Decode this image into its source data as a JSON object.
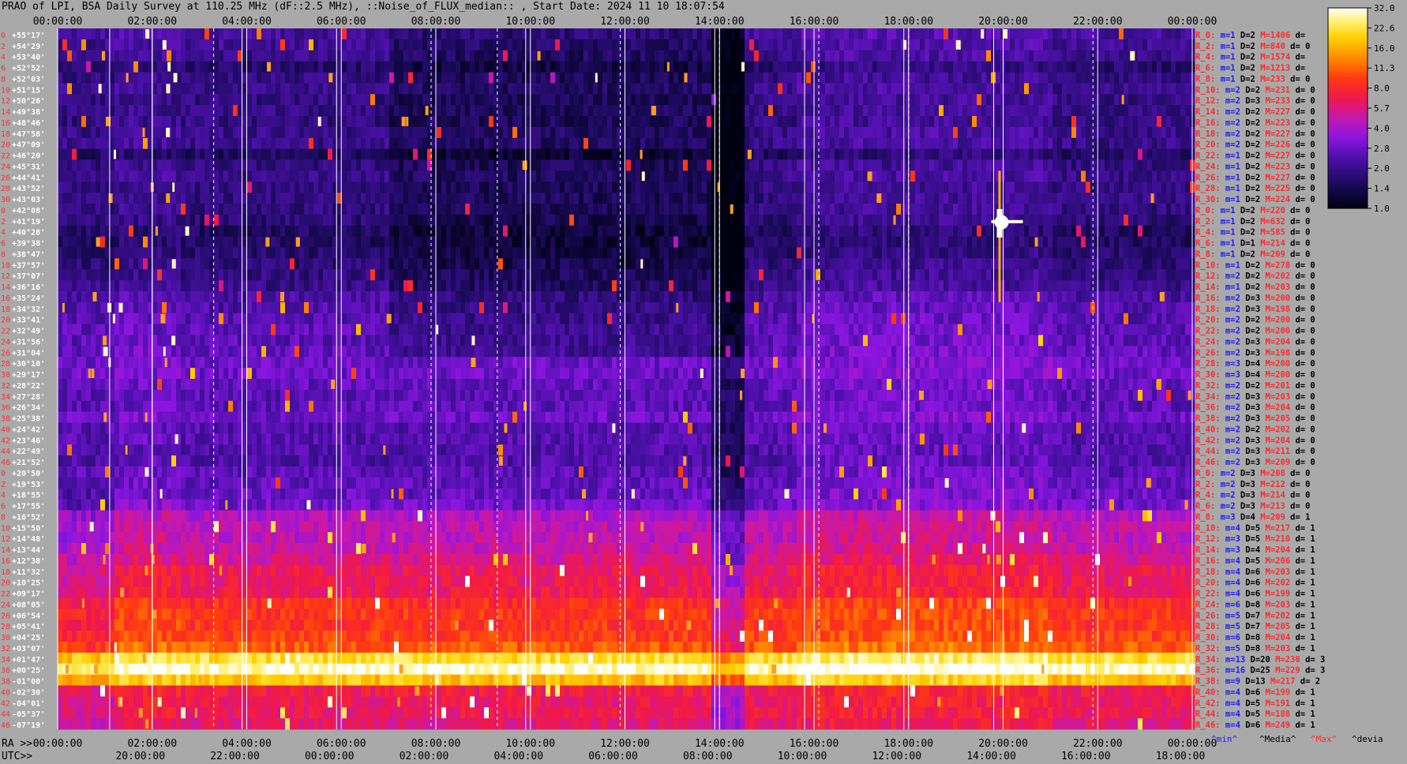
{
  "title": "PRAO of LPI, BSA Daily Survey at 110.25 MHz (dF::2.5 MHz), ::Noise_of_FLUX_median:: , Start Date: 2024 11 10 18:07:54",
  "colors": {
    "background": "#a9a9a9",
    "grid_line": "#ffffff",
    "left_labels": "#ff3030",
    "right_red": "#ff2a2a",
    "right_blue": "#1a1aff"
  },
  "chart_data": {
    "type": "heatmap",
    "title": "PRAO of LPI, BSA Daily Survey at 110.25 MHz (dF::2.5 MHz), ::Noise_of_FLUX_median:: , Start Date: 2024 11 10 18:07:54",
    "x_top_ticks": [
      "00:00:00",
      "02:00:00",
      "04:00:00",
      "06:00:00",
      "08:00:00",
      "10:00:00",
      "12:00:00",
      "14:00:00",
      "16:00:00",
      "18:00:00",
      "20:00:00",
      "22:00:00",
      "00:00:00"
    ],
    "x_bottom_ra_prefix": "RA >>",
    "x_bottom_ra_ticks": [
      "00:00:00",
      "02:00:00",
      "04:00:00",
      "06:00:00",
      "08:00:00",
      "10:00:00",
      "12:00:00",
      "14:00:00",
      "16:00:00",
      "18:00:00",
      "20:00:00",
      "22:00:00",
      "00:00:00"
    ],
    "x_bottom_utc_prefix": "UTC>>",
    "x_bottom_utc_ticks": [
      "20:00:00",
      "22:00:00",
      "00:00:00",
      "02:00:00",
      "04:00:00",
      "06:00:00",
      "08:00:00",
      "10:00:00",
      "12:00:00",
      "14:00:00",
      "16:00:00",
      "18:00:00"
    ],
    "rows": [
      {
        "idx": "0",
        "dec": "+55°17'"
      },
      {
        "idx": "2",
        "dec": "+54°29'"
      },
      {
        "idx": "4",
        "dec": "+53°40'"
      },
      {
        "idx": "6",
        "dec": "+52°52'"
      },
      {
        "idx": "8",
        "dec": "+52°03'"
      },
      {
        "idx": "10",
        "dec": "+51°15'"
      },
      {
        "idx": "12",
        "dec": "+50°26'"
      },
      {
        "idx": "14",
        "dec": "+49°38'"
      },
      {
        "idx": "16",
        "dec": "+48°46'"
      },
      {
        "idx": "18",
        "dec": "+47°58'"
      },
      {
        "idx": "20",
        "dec": "+47°09'"
      },
      {
        "idx": "22",
        "dec": "+46°20'"
      },
      {
        "idx": "24",
        "dec": "+45°31'"
      },
      {
        "idx": "26",
        "dec": "+44°41'"
      },
      {
        "idx": "28",
        "dec": "+43°52'"
      },
      {
        "idx": "30",
        "dec": "+43°03'"
      },
      {
        "idx": "0",
        "dec": "+42°08'"
      },
      {
        "idx": "2",
        "dec": "+41°19'"
      },
      {
        "idx": "4",
        "dec": "+40°28'"
      },
      {
        "idx": "6",
        "dec": "+39°38'"
      },
      {
        "idx": "8",
        "dec": "+38°47'"
      },
      {
        "idx": "10",
        "dec": "+37°57'"
      },
      {
        "idx": "12",
        "dec": "+37°07'"
      },
      {
        "idx": "14",
        "dec": "+36°16'"
      },
      {
        "idx": "16",
        "dec": "+35°24'"
      },
      {
        "idx": "18",
        "dec": "+34°32'"
      },
      {
        "idx": "20",
        "dec": "+33°41'"
      },
      {
        "idx": "22",
        "dec": "+32°49'"
      },
      {
        "idx": "24",
        "dec": "+31°56'"
      },
      {
        "idx": "26",
        "dec": "+31°04'"
      },
      {
        "idx": "28",
        "dec": "+30°10'"
      },
      {
        "idx": "30",
        "dec": "+29°17'"
      },
      {
        "idx": "32",
        "dec": "+28°22'"
      },
      {
        "idx": "34",
        "dec": "+27°28'"
      },
      {
        "idx": "36",
        "dec": "+26°34'"
      },
      {
        "idx": "38",
        "dec": "+25°38'"
      },
      {
        "idx": "40",
        "dec": "+24°42'"
      },
      {
        "idx": "42",
        "dec": "+23°46'"
      },
      {
        "idx": "44",
        "dec": "+22°49'"
      },
      {
        "idx": "46",
        "dec": "+21°52'"
      },
      {
        "idx": "0",
        "dec": "+20°50'"
      },
      {
        "idx": "2",
        "dec": "+19°53'"
      },
      {
        "idx": "4",
        "dec": "+18°55'"
      },
      {
        "idx": "6",
        "dec": "+17°55'"
      },
      {
        "idx": "8",
        "dec": "+16°52'"
      },
      {
        "idx": "10",
        "dec": "+15°50'"
      },
      {
        "idx": "12",
        "dec": "+14°48'"
      },
      {
        "idx": "14",
        "dec": "+13°44'"
      },
      {
        "idx": "16",
        "dec": "+12°38'"
      },
      {
        "idx": "18",
        "dec": "+11°32'"
      },
      {
        "idx": "20",
        "dec": "+10°25'"
      },
      {
        "idx": "22",
        "dec": "+09°17'"
      },
      {
        "idx": "24",
        "dec": "+08°05'"
      },
      {
        "idx": "26",
        "dec": "+06°54'"
      },
      {
        "idx": "28",
        "dec": "+05°41'"
      },
      {
        "idx": "30",
        "dec": "+04°25'"
      },
      {
        "idx": "32",
        "dec": "+03°07'"
      },
      {
        "idx": "34",
        "dec": "+01°47'"
      },
      {
        "idx": "36",
        "dec": "+00°25'"
      },
      {
        "idx": "38",
        "dec": "-01°00'"
      },
      {
        "idx": "40",
        "dec": "-02°30'"
      },
      {
        "idx": "42",
        "dec": "-04°01'"
      },
      {
        "idx": "44",
        "dec": "-05°37'"
      },
      {
        "idx": "46",
        "dec": "-07°19'"
      }
    ],
    "stats": [
      {
        "r": "R_0:",
        "m": "m=1",
        "D": "D=2",
        "M": "M=1406",
        "d": "d="
      },
      {
        "r": "R_2:",
        "m": "m=1",
        "D": "D=2",
        "M": "M=840",
        "d": "d= 0"
      },
      {
        "r": "R_4:",
        "m": "m=1",
        "D": "D=2",
        "M": "M=1574",
        "d": "d="
      },
      {
        "r": "R_6:",
        "m": "m=1",
        "D": "D=2",
        "M": "M=1213",
        "d": "d="
      },
      {
        "r": "R_8:",
        "m": "m=1",
        "D": "D=2",
        "M": "M=233",
        "d": "d= 0"
      },
      {
        "r": "R_10:",
        "m": "m=2",
        "D": "D=2",
        "M": "M=231",
        "d": "d= 0"
      },
      {
        "r": "R_12:",
        "m": "m=2",
        "D": "D=3",
        "M": "M=233",
        "d": "d= 0"
      },
      {
        "r": "R_14:",
        "m": "m=2",
        "D": "D=2",
        "M": "M=227",
        "d": "d= 0"
      },
      {
        "r": "R_16:",
        "m": "m=2",
        "D": "D=2",
        "M": "M=223",
        "d": "d= 0"
      },
      {
        "r": "R_18:",
        "m": "m=2",
        "D": "D=2",
        "M": "M=227",
        "d": "d= 0"
      },
      {
        "r": "R_20:",
        "m": "m=2",
        "D": "D=2",
        "M": "M=226",
        "d": "d= 0"
      },
      {
        "r": "R_22:",
        "m": "m=1",
        "D": "D=2",
        "M": "M=227",
        "d": "d= 0"
      },
      {
        "r": "R_24:",
        "m": "m=1",
        "D": "D=2",
        "M": "M=223",
        "d": "d= 0"
      },
      {
        "r": "R_26:",
        "m": "m=1",
        "D": "D=2",
        "M": "M=227",
        "d": "d= 0"
      },
      {
        "r": "R_28:",
        "m": "m=1",
        "D": "D=2",
        "M": "M=225",
        "d": "d= 0"
      },
      {
        "r": "R_30:",
        "m": "m=1",
        "D": "D=2",
        "M": "M=224",
        "d": "d= 0"
      },
      {
        "r": "R_0:",
        "m": "m=1",
        "D": "D=2",
        "M": "M=220",
        "d": "d= 0"
      },
      {
        "r": "R_2:",
        "m": "m=1",
        "D": "D=2",
        "M": "M=632",
        "d": "d= 0"
      },
      {
        "r": "R_4:",
        "m": "m=1",
        "D": "D=2",
        "M": "M=585",
        "d": "d= 0"
      },
      {
        "r": "R_6:",
        "m": "m=1",
        "D": "D=1",
        "M": "M=214",
        "d": "d= 0"
      },
      {
        "r": "R_8:",
        "m": "m=1",
        "D": "D=2",
        "M": "M=209",
        "d": "d= 0"
      },
      {
        "r": "R_10:",
        "m": "m=1",
        "D": "D=2",
        "M": "M=278",
        "d": "d= 0"
      },
      {
        "r": "R_12:",
        "m": "m=2",
        "D": "D=2",
        "M": "M=202",
        "d": "d= 0"
      },
      {
        "r": "R_14:",
        "m": "m=1",
        "D": "D=2",
        "M": "M=203",
        "d": "d= 0"
      },
      {
        "r": "R_16:",
        "m": "m=2",
        "D": "D=3",
        "M": "M=200",
        "d": "d= 0"
      },
      {
        "r": "R_18:",
        "m": "m=2",
        "D": "D=3",
        "M": "M=198",
        "d": "d= 0"
      },
      {
        "r": "R_20:",
        "m": "m=2",
        "D": "D=2",
        "M": "M=200",
        "d": "d= 0"
      },
      {
        "r": "R_22:",
        "m": "m=2",
        "D": "D=2",
        "M": "M=200",
        "d": "d= 0"
      },
      {
        "r": "R_24:",
        "m": "m=2",
        "D": "D=3",
        "M": "M=204",
        "d": "d= 0"
      },
      {
        "r": "R_26:",
        "m": "m=2",
        "D": "D=3",
        "M": "M=198",
        "d": "d= 0"
      },
      {
        "r": "R_28:",
        "m": "m=3",
        "D": "D=4",
        "M": "M=200",
        "d": "d= 0"
      },
      {
        "r": "R_30:",
        "m": "m=3",
        "D": "D=4",
        "M": "M=200",
        "d": "d= 0"
      },
      {
        "r": "R_32:",
        "m": "m=2",
        "D": "D=2",
        "M": "M=201",
        "d": "d= 0"
      },
      {
        "r": "R_34:",
        "m": "m=2",
        "D": "D=3",
        "M": "M=203",
        "d": "d= 0"
      },
      {
        "r": "R_36:",
        "m": "m=2",
        "D": "D=3",
        "M": "M=204",
        "d": "d= 0"
      },
      {
        "r": "R_38:",
        "m": "m=2",
        "D": "D=3",
        "M": "M=205",
        "d": "d= 0"
      },
      {
        "r": "R_40:",
        "m": "m=2",
        "D": "D=2",
        "M": "M=202",
        "d": "d= 0"
      },
      {
        "r": "R_42:",
        "m": "m=2",
        "D": "D=3",
        "M": "M=204",
        "d": "d= 0"
      },
      {
        "r": "R_44:",
        "m": "m=2",
        "D": "D=3",
        "M": "M=211",
        "d": "d= 0"
      },
      {
        "r": "R_46:",
        "m": "m=2",
        "D": "D=3",
        "M": "M=209",
        "d": "d= 0"
      },
      {
        "r": "R_0:",
        "m": "m=2",
        "D": "D=3",
        "M": "M=208",
        "d": "d= 0"
      },
      {
        "r": "R_2:",
        "m": "m=2",
        "D": "D=3",
        "M": "M=212",
        "d": "d= 0"
      },
      {
        "r": "R_4:",
        "m": "m=2",
        "D": "D=3",
        "M": "M=214",
        "d": "d= 0"
      },
      {
        "r": "R_6:",
        "m": "m=2",
        "D": "D=3",
        "M": "M=213",
        "d": "d= 0"
      },
      {
        "r": "R_8:",
        "m": "m=3",
        "D": "D=4",
        "M": "M=209",
        "d": "d= 1"
      },
      {
        "r": "R_10:",
        "m": "m=4",
        "D": "D=5",
        "M": "M=217",
        "d": "d= 1"
      },
      {
        "r": "R_12:",
        "m": "m=3",
        "D": "D=5",
        "M": "M=210",
        "d": "d= 1"
      },
      {
        "r": "R_14:",
        "m": "m=3",
        "D": "D=4",
        "M": "M=204",
        "d": "d= 1"
      },
      {
        "r": "R_16:",
        "m": "m=4",
        "D": "D=5",
        "M": "M=206",
        "d": "d= 1"
      },
      {
        "r": "R_18:",
        "m": "m=4",
        "D": "D=6",
        "M": "M=203",
        "d": "d= 1"
      },
      {
        "r": "R_20:",
        "m": "m=4",
        "D": "D=6",
        "M": "M=202",
        "d": "d= 1"
      },
      {
        "r": "R_22:",
        "m": "m=4",
        "D": "D=6",
        "M": "M=199",
        "d": "d= 1"
      },
      {
        "r": "R_24:",
        "m": "m=6",
        "D": "D=8",
        "M": "M=203",
        "d": "d= 1"
      },
      {
        "r": "R_26:",
        "m": "m=5",
        "D": "D=7",
        "M": "M=202",
        "d": "d= 1"
      },
      {
        "r": "R_28:",
        "m": "m=5",
        "D": "D=7",
        "M": "M=205",
        "d": "d= 1"
      },
      {
        "r": "R_30:",
        "m": "m=6",
        "D": "D=8",
        "M": "M=204",
        "d": "d= 1"
      },
      {
        "r": "R_32:",
        "m": "m=5",
        "D": "D=8",
        "M": "M=203",
        "d": "d= 1"
      },
      {
        "r": "R_34:",
        "m": "m=13",
        "D": "D=20",
        "M": "M=230",
        "d": "d= 3"
      },
      {
        "r": "R_36:",
        "m": "m=16",
        "D": "D=25",
        "M": "M=229",
        "d": "d= 3"
      },
      {
        "r": "R_38:",
        "m": "m=9",
        "D": "D=13",
        "M": "M=217",
        "d": "d= 2"
      },
      {
        "r": "R_40:",
        "m": "m=4",
        "D": "D=6",
        "M": "M=199",
        "d": "d= 1"
      },
      {
        "r": "R_42:",
        "m": "m=4",
        "D": "D=5",
        "M": "M=191",
        "d": "d= 1"
      },
      {
        "r": "R_44:",
        "m": "m=4",
        "D": "D=5",
        "M": "M=188",
        "d": "d= 1"
      },
      {
        "r": "R_46:",
        "m": "m=4",
        "D": "D=6",
        "M": "M=249",
        "d": "d= 1"
      }
    ],
    "stats_footer": {
      "min": "^min^",
      "median": "^Media^",
      "max": "^Max^",
      "dev": "^devia"
    },
    "colorbar": {
      "scale": "log",
      "ticks": [
        "32.0",
        "22.6",
        "16.0",
        "11.3",
        "8.0",
        "5.7",
        "4.0",
        "2.8",
        "2.0",
        "1.4",
        "1.0"
      ],
      "range": [
        1.0,
        32.0
      ]
    },
    "row_levels": [
      2.2,
      2.1,
      2.0,
      1.7,
      1.9,
      2.0,
      1.9,
      1.9,
      1.9,
      2.0,
      2.0,
      1.6,
      1.9,
      2.0,
      1.9,
      1.9,
      1.9,
      1.8,
      1.6,
      1.6,
      1.7,
      1.8,
      1.9,
      2.0,
      2.3,
      2.4,
      2.5,
      2.6,
      2.6,
      2.7,
      2.9,
      2.9,
      2.7,
      2.6,
      2.6,
      2.9,
      2.5,
      2.5,
      2.4,
      2.4,
      2.6,
      2.7,
      2.8,
      3.0,
      4.2,
      4.6,
      4.6,
      4.8,
      5.5,
      6.5,
      6.5,
      6.8,
      8.5,
      9.0,
      9.0,
      9.5,
      11.0,
      22.0,
      30.0,
      18.0,
      7.0,
      6.5,
      6.5,
      6.0
    ]
  }
}
